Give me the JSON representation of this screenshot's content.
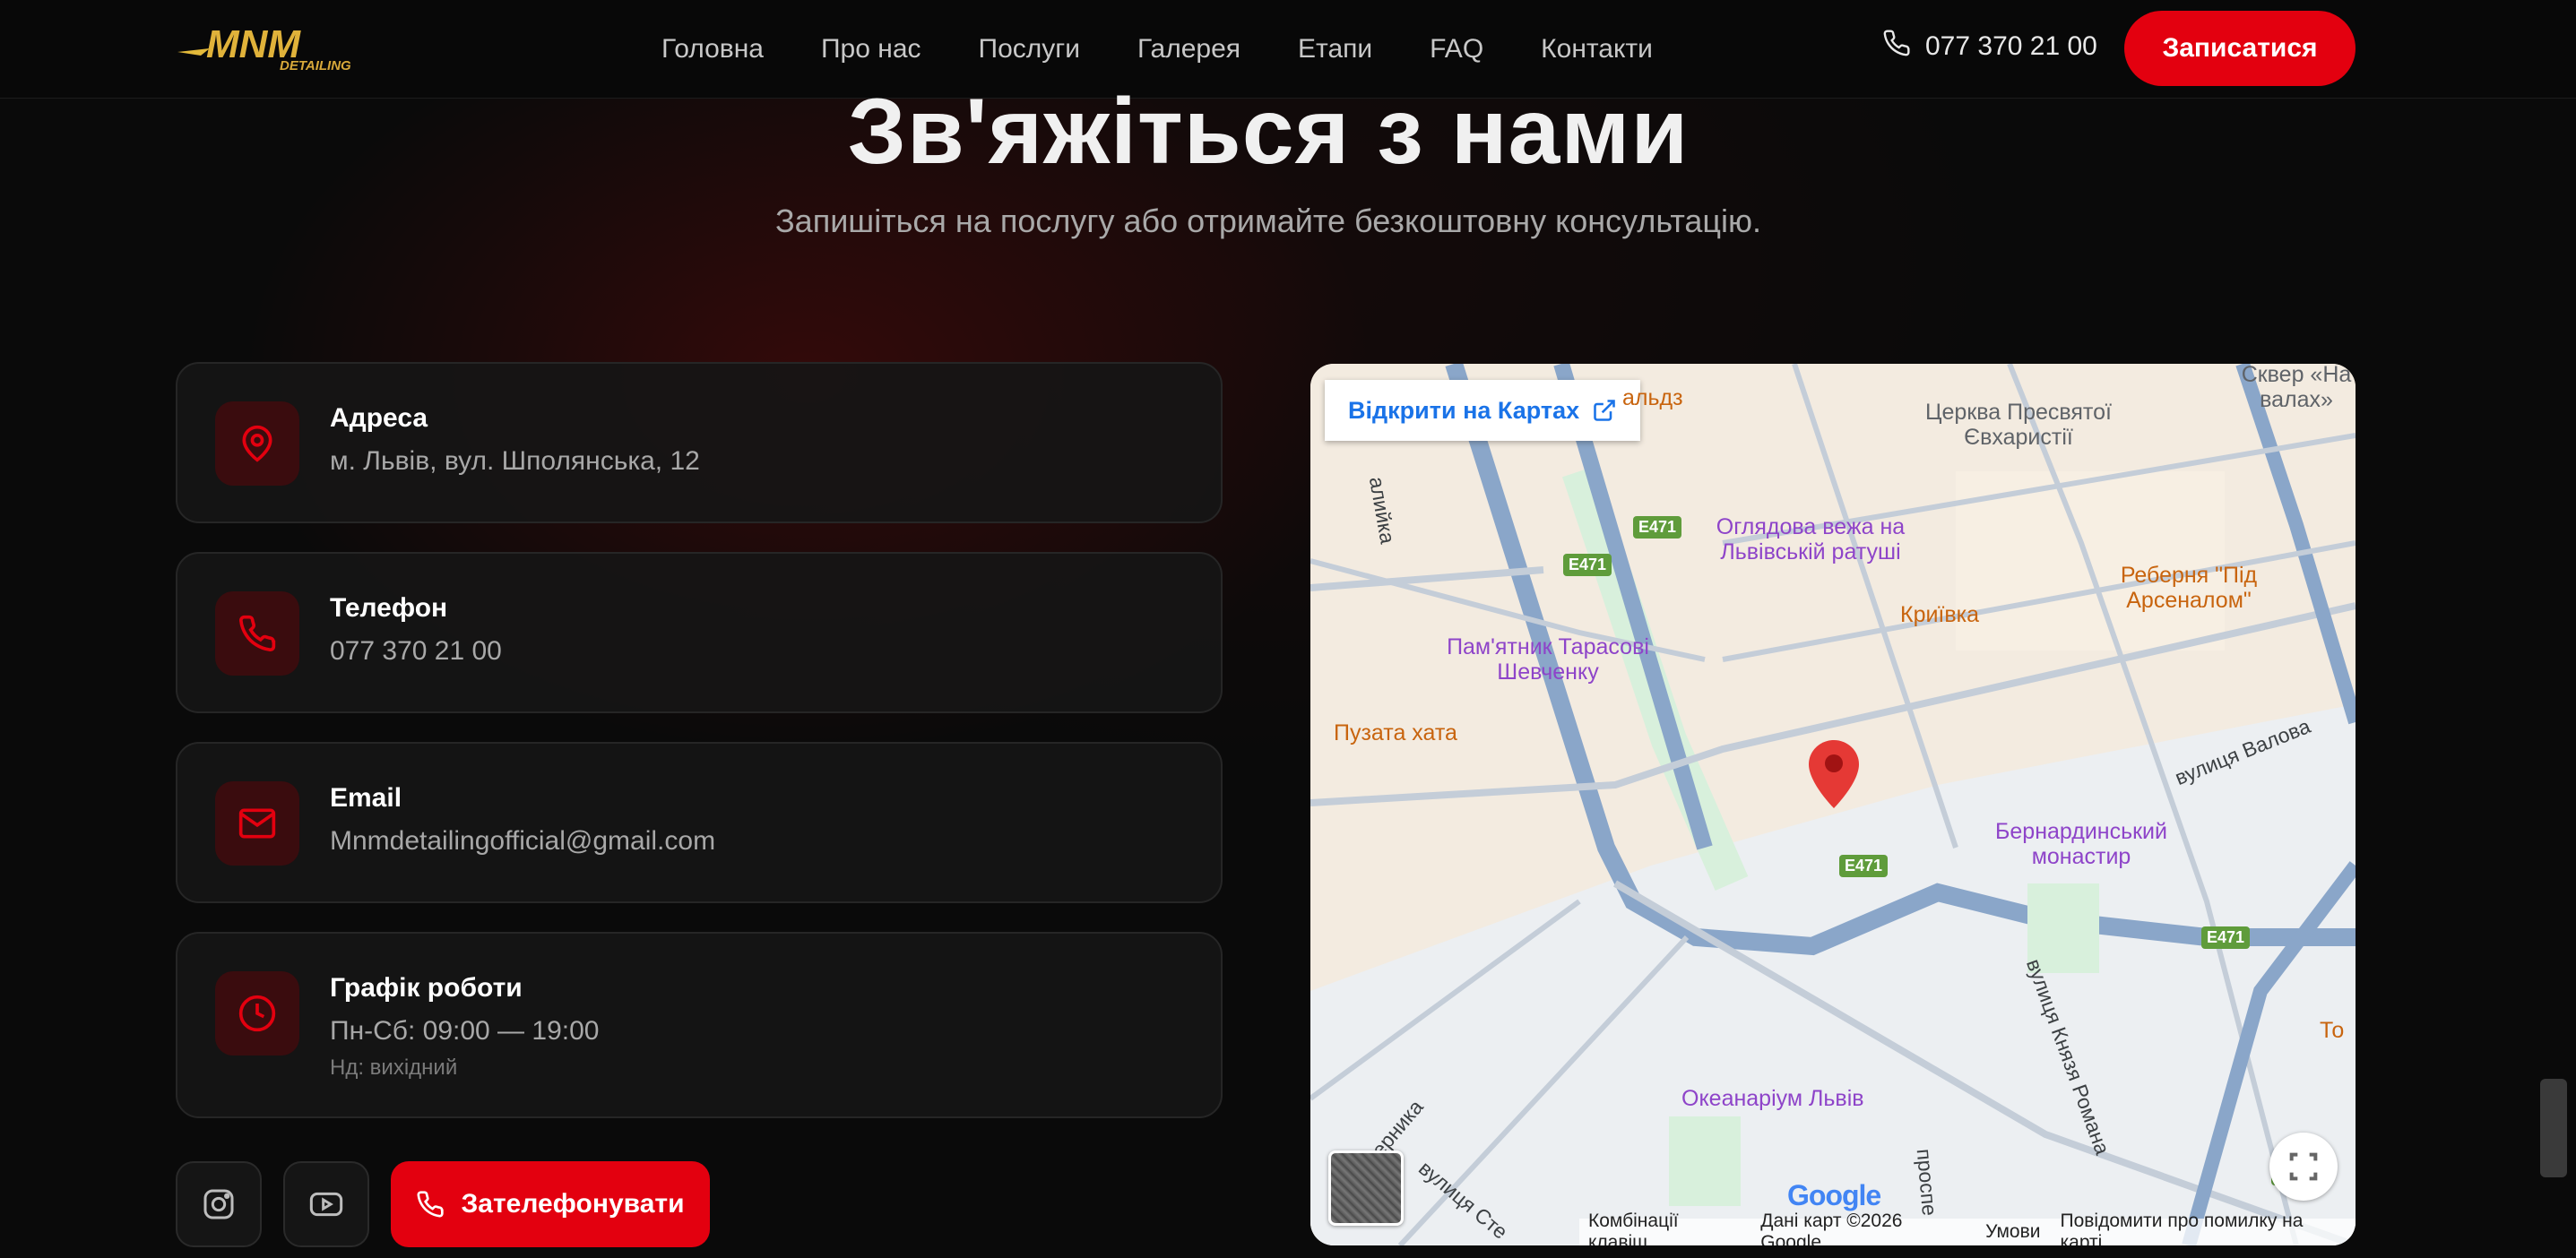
{
  "header": {
    "logo_text": "MNM",
    "logo_sub": "DETAILING",
    "nav": [
      "Головна",
      "Про нас",
      "Послуги",
      "Галерея",
      "Етапи",
      "FAQ",
      "Контакти"
    ],
    "phone": "077 370 21 00",
    "cta": "Записатися"
  },
  "hero": {
    "title": "Зв'яжіться з нами",
    "subtitle": "Запишіться на послугу або отримайте безкоштовну консультацію."
  },
  "cards": {
    "address": {
      "label": "Адреса",
      "value": "м. Львів, вул. Шполянська, 12",
      "icon": "map-pin-icon"
    },
    "phone": {
      "label": "Телефон",
      "value": "077 370 21 00",
      "icon": "phone-icon"
    },
    "email": {
      "label": "Email",
      "value": "Mnmdetailingofficial@gmail.com",
      "icon": "mail-icon"
    },
    "hours": {
      "label": "Графік роботи",
      "value": "Пн-Сб: 09:00 — 19:00",
      "note": "Нд: вихідний",
      "icon": "clock-icon"
    }
  },
  "actions": {
    "call": "Зателефонувати"
  },
  "map": {
    "open_link": "Відкрити на Картах",
    "pois": {
      "church": "Церква Пресвятої Євхаристії",
      "tower": "Оглядова вежа на Львівській ратуші",
      "rebernia": "Реберня \"Під Арсеналом\"",
      "kryivka": "Криївка",
      "monument": "Пам'ятник Тарасові Шевченку",
      "puzata": "Пузата хата",
      "bernardine": "Бернардинський монастир",
      "oceanarium": "Океанаріум Львів",
      "skver": "Сквер «На валах»",
      "shop_fragment": "альдз",
      "right_fragment": "То"
    },
    "streets": {
      "valova": "вулиця Валова",
      "romana": "вулиця Князя Романа",
      "left_street": "алийка",
      "pernyka": "ерника",
      "stefanyka": "вулиця Сте",
      "prospekt": "проспе"
    },
    "road_badge": "E471",
    "footer": [
      "Комбінації клавіш",
      "Дані карт ©2026 Google",
      "Умови",
      "Повідомити про помилку на карті"
    ],
    "google": "Google"
  },
  "colors": {
    "accent": "#e3000f",
    "background": "#0a0a0a",
    "card": "#161616"
  }
}
